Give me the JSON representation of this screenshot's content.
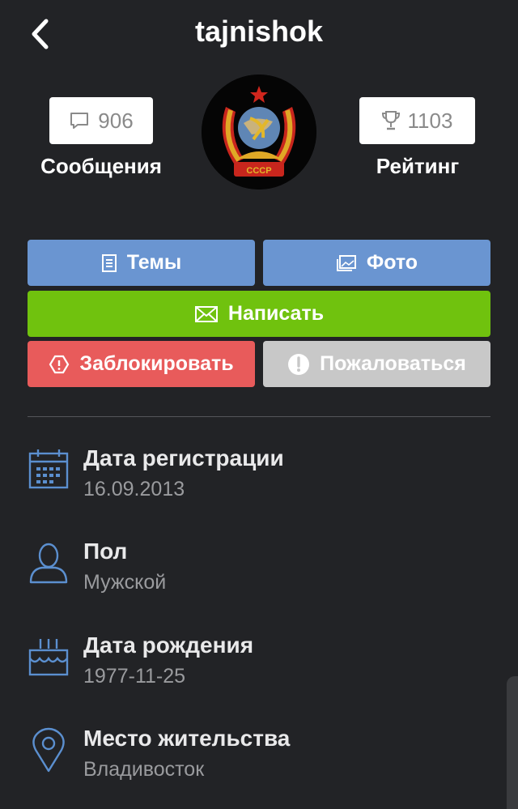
{
  "header": {
    "title": "tajnishok"
  },
  "stats": {
    "messages_count": "906",
    "messages_label": "Сообщения",
    "rating_count": "1103",
    "rating_label": "Рейтинг"
  },
  "avatar": {
    "caption": "СССР"
  },
  "actions": {
    "topics": "Темы",
    "photo": "Фото",
    "write": "Написать",
    "block": "Заблокировать",
    "report": "Пожаловаться"
  },
  "info": [
    {
      "label": "Дата регистрации",
      "value": "16.09.2013",
      "icon": "calendar-icon"
    },
    {
      "label": "Пол",
      "value": "Мужской",
      "icon": "user-icon"
    },
    {
      "label": "Дата рождения",
      "value": "1977-11-25",
      "icon": "birthday-cake-icon"
    },
    {
      "label": "Место жительства",
      "value": "Владивосток",
      "icon": "location-pin-icon"
    }
  ],
  "colors": {
    "background": "#222326",
    "primary_blue": "#6a95d1",
    "write_green": "#70c20e",
    "block_red": "#e85b5b",
    "report_gray": "#c8c8c8",
    "icon_blue": "#5b8fcf"
  }
}
